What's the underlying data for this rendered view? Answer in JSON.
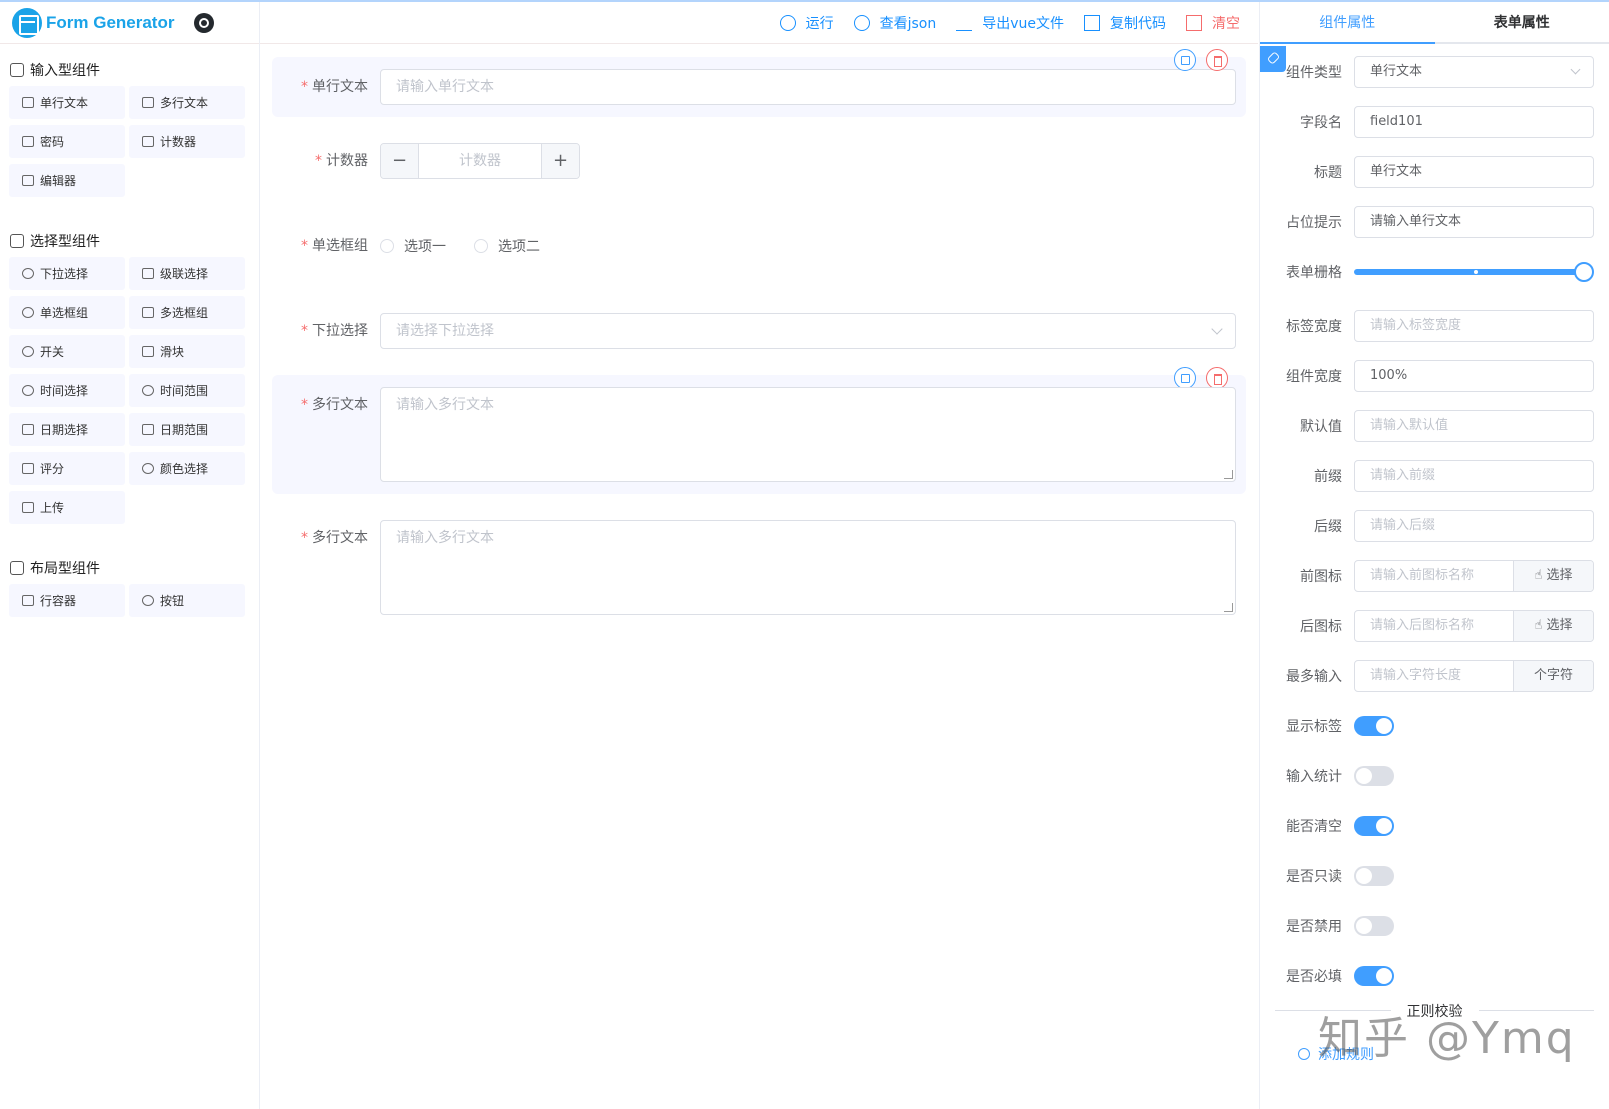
{
  "app": {
    "title": "Form Generator"
  },
  "toolbar": {
    "run": "运行",
    "view_json": "查看json",
    "export_vue": "导出vue文件",
    "copy_code": "复制代码",
    "clear": "清空"
  },
  "sidebar": {
    "groups": [
      {
        "title": "输入型组件",
        "items": [
          "单行文本",
          "多行文本",
          "密码",
          "计数器",
          "编辑器"
        ]
      },
      {
        "title": "选择型组件",
        "items": [
          "下拉选择",
          "级联选择",
          "单选框组",
          "多选框组",
          "开关",
          "滑块",
          "时间选择",
          "时间范围",
          "日期选择",
          "日期范围",
          "评分",
          "颜色选择",
          "上传"
        ]
      },
      {
        "title": "布局型组件",
        "items": [
          "行容器",
          "按钮"
        ]
      }
    ]
  },
  "form": {
    "required_mark": "*",
    "single_text": {
      "label": "单行文本",
      "placeholder": "请输入单行文本"
    },
    "counter": {
      "label": "计数器",
      "placeholder": "计数器",
      "minus": "−",
      "plus": "+"
    },
    "radio": {
      "label": "单选框组",
      "options": [
        "选项一",
        "选项二"
      ]
    },
    "select": {
      "label": "下拉选择",
      "placeholder": "请选择下拉选择"
    },
    "textarea1": {
      "label": "多行文本",
      "placeholder": "请输入多行文本"
    },
    "textarea2": {
      "label": "多行文本",
      "placeholder": "请输入多行文本"
    }
  },
  "tabs": {
    "component_props": "组件属性",
    "form_props": "表单属性"
  },
  "props": {
    "component_type": {
      "label": "组件类型",
      "value": "单行文本"
    },
    "field_name": {
      "label": "字段名",
      "value": "field101"
    },
    "title": {
      "label": "标题",
      "value": "单行文本"
    },
    "placeholder": {
      "label": "占位提示",
      "value": "请输入单行文本"
    },
    "grid": {
      "label": "表单栅格",
      "value": 1.0
    },
    "label_width": {
      "label": "标签宽度",
      "placeholder": "请输入标签宽度"
    },
    "component_width": {
      "label": "组件宽度",
      "value": "100%"
    },
    "default_value": {
      "label": "默认值",
      "placeholder": "请输入默认值"
    },
    "prefix": {
      "label": "前缀",
      "placeholder": "请输入前缀"
    },
    "suffix": {
      "label": "后缀",
      "placeholder": "请输入后缀"
    },
    "prefix_icon": {
      "label": "前图标",
      "placeholder": "请输入前图标名称",
      "button": "选择"
    },
    "suffix_icon": {
      "label": "后图标",
      "placeholder": "请输入后图标名称",
      "button": "选择"
    },
    "max_length": {
      "label": "最多输入",
      "placeholder": "请输入字符长度",
      "append": "个字符"
    },
    "show_label": {
      "label": "显示标签",
      "on": true
    },
    "word_limit": {
      "label": "输入统计",
      "on": false
    },
    "clearable": {
      "label": "能否清空",
      "on": true
    },
    "readonly": {
      "label": "是否只读",
      "on": false
    },
    "disabled": {
      "label": "是否禁用",
      "on": false
    },
    "required": {
      "label": "是否必填",
      "on": true
    },
    "regex_title": "正则校验",
    "add_rule": "添加规则"
  },
  "watermark": "知乎 @Ymq",
  "colors": {
    "primary": "#409eff",
    "danger": "#f56c6c",
    "brand": "#1aa3e8"
  }
}
